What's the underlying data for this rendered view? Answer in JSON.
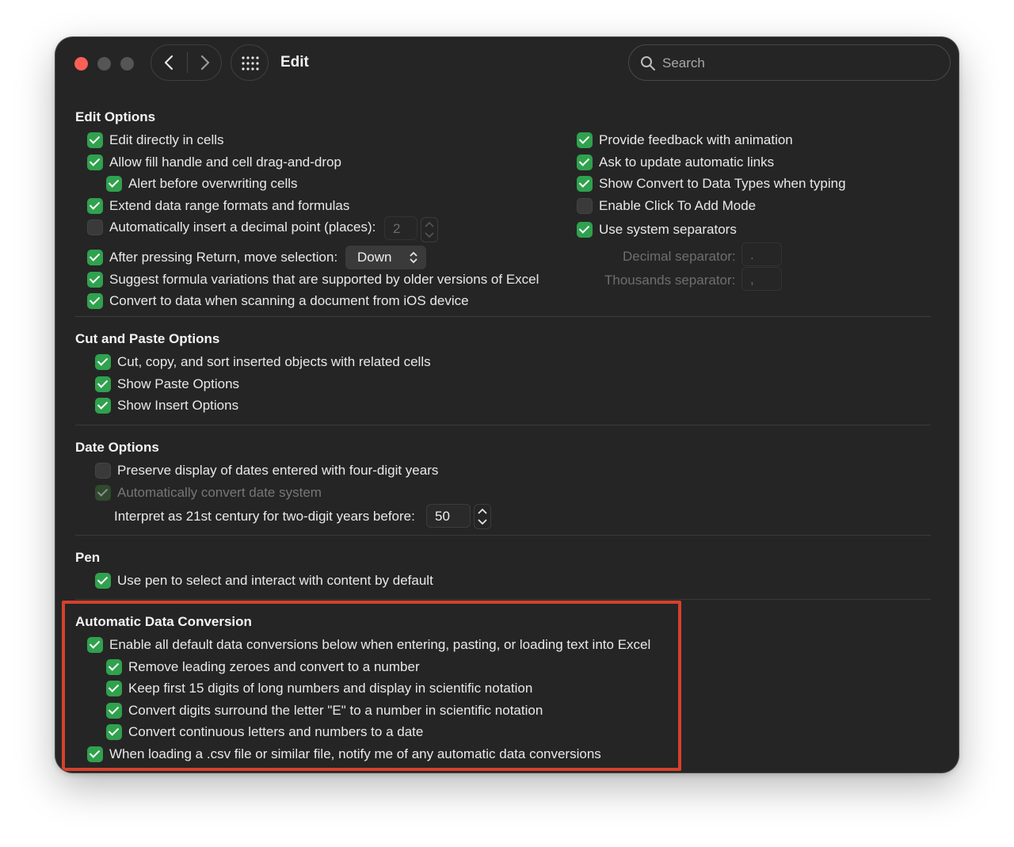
{
  "titlebar": {
    "title": "Edit",
    "back_icon": "chevron-left-icon",
    "forward_icon": "chevron-right-icon",
    "grid_icon": "grid-icon",
    "search_placeholder": "Search"
  },
  "colors": {
    "check_on": "#30a14e",
    "highlight_border": "#d7402b",
    "background": "#252525"
  },
  "edit_options": {
    "title": "Edit Options",
    "left": [
      {
        "label": "Edit directly in cells",
        "checked": true
      },
      {
        "label": "Allow fill handle and cell drag-and-drop",
        "checked": true
      },
      {
        "label": "Alert before overwriting cells",
        "checked": true
      },
      {
        "label": "Extend data range formats and formulas",
        "checked": true
      },
      {
        "label": "Automatically insert a decimal point (places):",
        "checked": false
      },
      {
        "label": "After pressing Return, move selection:",
        "checked": true
      },
      {
        "label": "Suggest formula variations that are supported by older versions of Excel",
        "checked": true
      },
      {
        "label": "Convert to data when scanning a document from iOS device",
        "checked": true
      }
    ],
    "decimal_places_value": "2",
    "move_selection_value": "Down",
    "right": [
      {
        "label": "Provide feedback with animation",
        "checked": true
      },
      {
        "label": "Ask to update automatic links",
        "checked": true
      },
      {
        "label": "Show Convert to Data Types when typing",
        "checked": true
      },
      {
        "label": "Enable Click To Add Mode",
        "checked": false
      },
      {
        "label": "Use system separators",
        "checked": true
      }
    ],
    "decimal_separator_label": "Decimal separator:",
    "decimal_separator_value": ".",
    "thousands_separator_label": "Thousands separator:",
    "thousands_separator_value": ","
  },
  "cut_paste": {
    "title": "Cut and Paste Options",
    "items": [
      {
        "label": "Cut, copy, and sort inserted objects with related cells",
        "checked": true
      },
      {
        "label": "Show Paste Options",
        "checked": true
      },
      {
        "label": "Show Insert Options",
        "checked": true
      }
    ]
  },
  "date_options": {
    "title": "Date Options",
    "items": [
      {
        "label": "Preserve display of dates entered with four-digit years",
        "checked": false
      },
      {
        "label": "Automatically convert date system",
        "checked": true,
        "disabled": true
      }
    ],
    "century_label": "Interpret as 21st century for two-digit years before:",
    "century_value": "50"
  },
  "pen": {
    "title": "Pen",
    "items": [
      {
        "label": "Use pen to select and interact with content by default",
        "checked": true
      }
    ]
  },
  "auto_conversion": {
    "title": "Automatic Data Conversion",
    "items": [
      {
        "label": "Enable all default data conversions below when entering, pasting, or loading text into Excel",
        "checked": true
      },
      {
        "label": "Remove leading zeroes and convert to a number",
        "checked": true
      },
      {
        "label": "Keep first 15 digits of long numbers and display in scientific notation",
        "checked": true
      },
      {
        "label": "Convert digits surround the letter \"E\" to a number in scientific notation",
        "checked": true
      },
      {
        "label": "Convert continuous letters and numbers to a date",
        "checked": true
      },
      {
        "label": "When loading a .csv file or similar file, notify me of any automatic data conversions",
        "checked": true
      }
    ]
  }
}
